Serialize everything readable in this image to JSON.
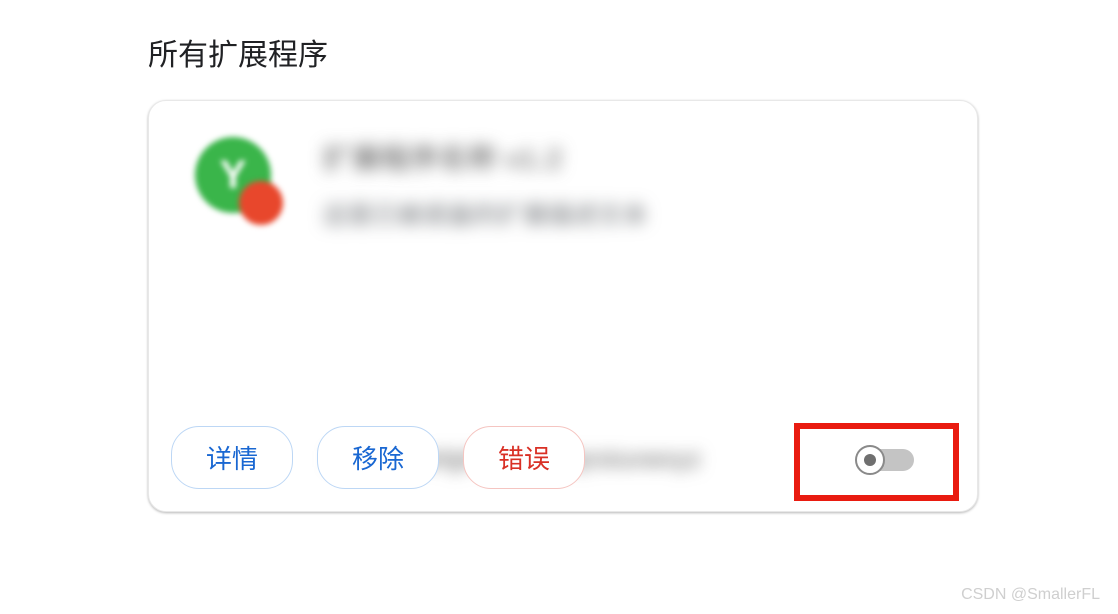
{
  "page": {
    "title": "所有扩展程序"
  },
  "extension": {
    "name": "扩展程序名称 v1.2",
    "description": "这是已被遮盖的扩展描述文本",
    "id_line": "ID: abcdefghijklmnopqrstuvwxyz",
    "enabled": false
  },
  "buttons": {
    "details": "详情",
    "remove": "移除",
    "errors": "错误"
  },
  "watermark": "CSDN @SmallerFL",
  "colors": {
    "accent_blue": "#1967d2",
    "error_red": "#d93025",
    "icon_green": "#3ab54a",
    "icon_orange": "#e8472c",
    "highlight_border": "#e91b10"
  }
}
